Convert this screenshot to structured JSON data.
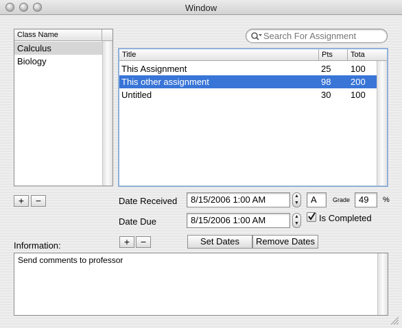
{
  "window": {
    "title": "Window"
  },
  "class_list": {
    "header": "Class Name",
    "items": [
      {
        "label": "Calculus"
      },
      {
        "label": "Biology"
      }
    ],
    "add_label": "+",
    "remove_label": "−"
  },
  "search": {
    "placeholder": "Search For Assignment",
    "value": ""
  },
  "assignments": {
    "columns": [
      "Title",
      "Pts",
      "Tota"
    ],
    "rows": [
      {
        "title": "This Assignment",
        "pts": "25",
        "total": "100"
      },
      {
        "title": "This other assignment",
        "pts": "98",
        "total": "200"
      },
      {
        "title": "Untitled",
        "pts": "30",
        "total": "100"
      }
    ],
    "selected_row": "This other assignment",
    "selection_color": "#3875d7"
  },
  "details": {
    "date_received_label": "Date Received",
    "date_received_value": "8/15/2006  1:00 AM",
    "date_due_label": "Date Due",
    "date_due_value": "8/15/2006  1:00 AM",
    "grade_letter": "A",
    "grade_label": "Grade",
    "grade_percent": "49",
    "percent_sign": "%",
    "is_completed_label": "Is Completed",
    "is_completed_checked": true,
    "add_label": "+",
    "remove_label": "−",
    "set_dates_label": "Set Dates",
    "remove_dates_label": "Remove Dates"
  },
  "information": {
    "label": "Information:",
    "text": "Send comments to professor"
  }
}
